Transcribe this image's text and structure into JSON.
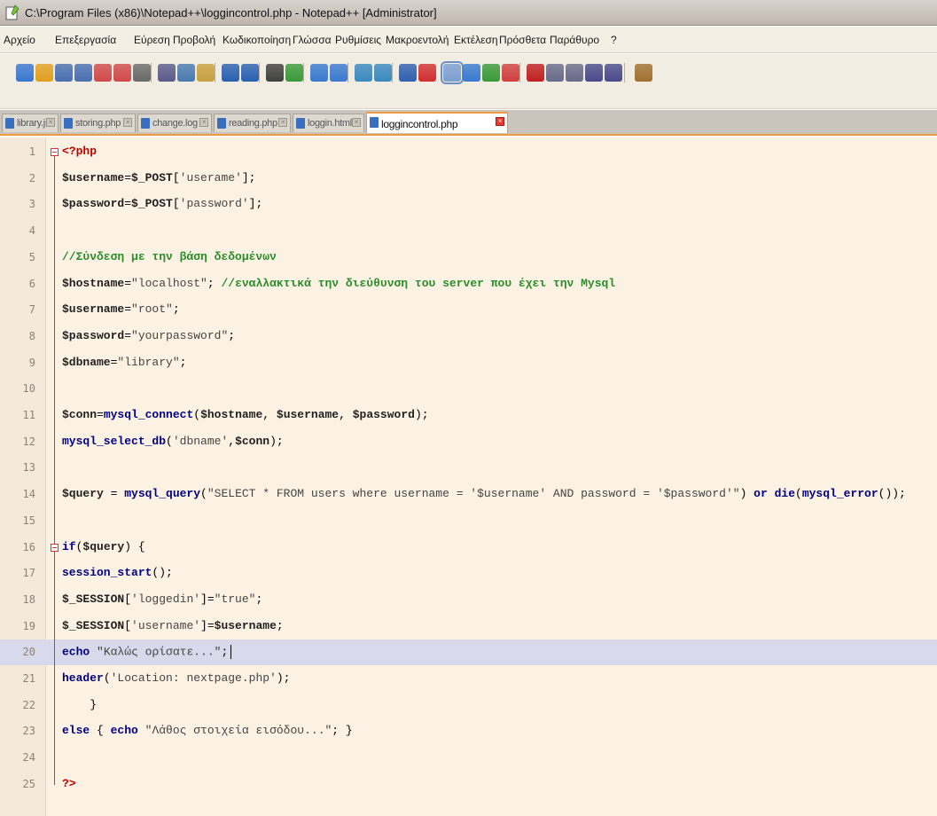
{
  "window": {
    "title": "C:\\Program Files (x86)\\Notepad++\\loggincontrol.php - Notepad++ [Administrator]"
  },
  "menu": [
    "Αρχείο",
    "Επεξεργασία",
    "Εύρεση",
    "Προβολή",
    "Κωδικοποίηση",
    "Γλώσσα",
    "Ρυθμίσεις",
    "Μακροεντολή",
    "Εκτέλεση",
    "Πρόσθετα",
    "Παράθυρο",
    "?"
  ],
  "tabs": [
    {
      "label": "library.js",
      "active": false
    },
    {
      "label": "storing.php",
      "active": false
    },
    {
      "label": "change.log",
      "active": false
    },
    {
      "label": "reading.php",
      "active": false
    },
    {
      "label": "loggin.html",
      "active": false
    },
    {
      "label": "loggincontrol.php",
      "active": true
    }
  ],
  "toolbar_icons": [
    "new-file-icon",
    "open-file-icon",
    "save-icon",
    "save-all-icon",
    "close-icon",
    "close-all-icon",
    "print-icon",
    "cut-icon",
    "copy-icon",
    "paste-icon",
    "undo-icon",
    "redo-icon",
    "find-icon",
    "replace-icon",
    "zoom-in-icon",
    "zoom-out-icon",
    "sync-vertical-icon",
    "sync-horizontal-icon",
    "word-wrap-icon",
    "show-all-chars-icon",
    "indent-guide-icon",
    "doc-map-icon",
    "function-list-icon",
    "folder-workspace-icon",
    "record-macro-icon",
    "stop-macro-icon",
    "play-macro-icon",
    "run-macro-multiple-icon",
    "save-macro-icon",
    "spell-check-icon"
  ],
  "code_lines": [
    "<?php",
    "$username=$_POST['userame'];",
    "$password=$_POST['password'];",
    "",
    "//Σύνδεση με την βάση δεδομένων",
    "$hostname=\"localhost\"; //εναλλακτικά την διεύθυνση του server που έχει την Mysql",
    "$username=\"root\";",
    "$password=\"yourpassword\";",
    "$dbname=\"library\";",
    "",
    "$conn=mysql_connect($hostname, $username, $password);",
    "mysql_select_db('dbname',$conn);",
    "",
    "$query = mysql_query(\"SELECT * FROM users where username = '$username' AND password = '$password'\") or die(mysql_error());",
    "",
    "if($query) {",
    "session_start();",
    "$_SESSION['loggedin']=\"true\";",
    "$_SESSION['username']=$username;",
    "echo \"Καλώς ορίσατε...\";",
    "header('Location: nextpage.php');",
    "    }",
    "else { echo \"Λάθος στοιχεία εισόδου...\"; }",
    "",
    "?>"
  ],
  "editor": {
    "current_line": 20
  }
}
